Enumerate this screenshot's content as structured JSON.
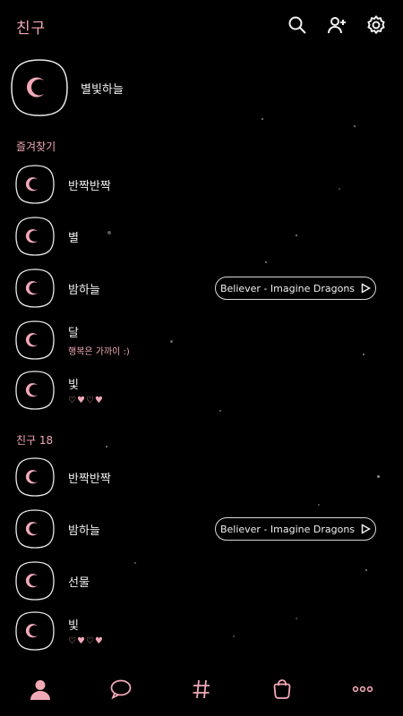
{
  "header": {
    "title": "친구"
  },
  "profile": {
    "name": "별빛하늘"
  },
  "favorites": {
    "label": "즐겨찾기",
    "items": [
      {
        "name": "반짝반짝",
        "status": ""
      },
      {
        "name": "별",
        "status": ""
      },
      {
        "name": "밤하늘",
        "status": "",
        "music": "Believer - Imagine Dragons"
      },
      {
        "name": "달",
        "status": "행복은 가까이 :)"
      },
      {
        "name": "빛",
        "status": "♡♥♡♥"
      }
    ]
  },
  "friends": {
    "label": "친구 18",
    "items": [
      {
        "name": "반짝반짝",
        "status": ""
      },
      {
        "name": "밤하늘",
        "status": "",
        "music": "Believer - Imagine Dragons"
      },
      {
        "name": "선물",
        "status": ""
      },
      {
        "name": "빛",
        "status": "♡♥♡♥"
      }
    ]
  },
  "colors": {
    "accent": "#f2a9b6",
    "background": "#000000",
    "outline": "#e8e8e8"
  },
  "icons": {
    "header": [
      "search-icon",
      "add-friend-icon",
      "settings-icon"
    ],
    "tabs": [
      "friends-tab-icon",
      "chat-tab-icon",
      "hashtag-tab-icon",
      "shopping-tab-icon",
      "more-tab-icon"
    ]
  }
}
